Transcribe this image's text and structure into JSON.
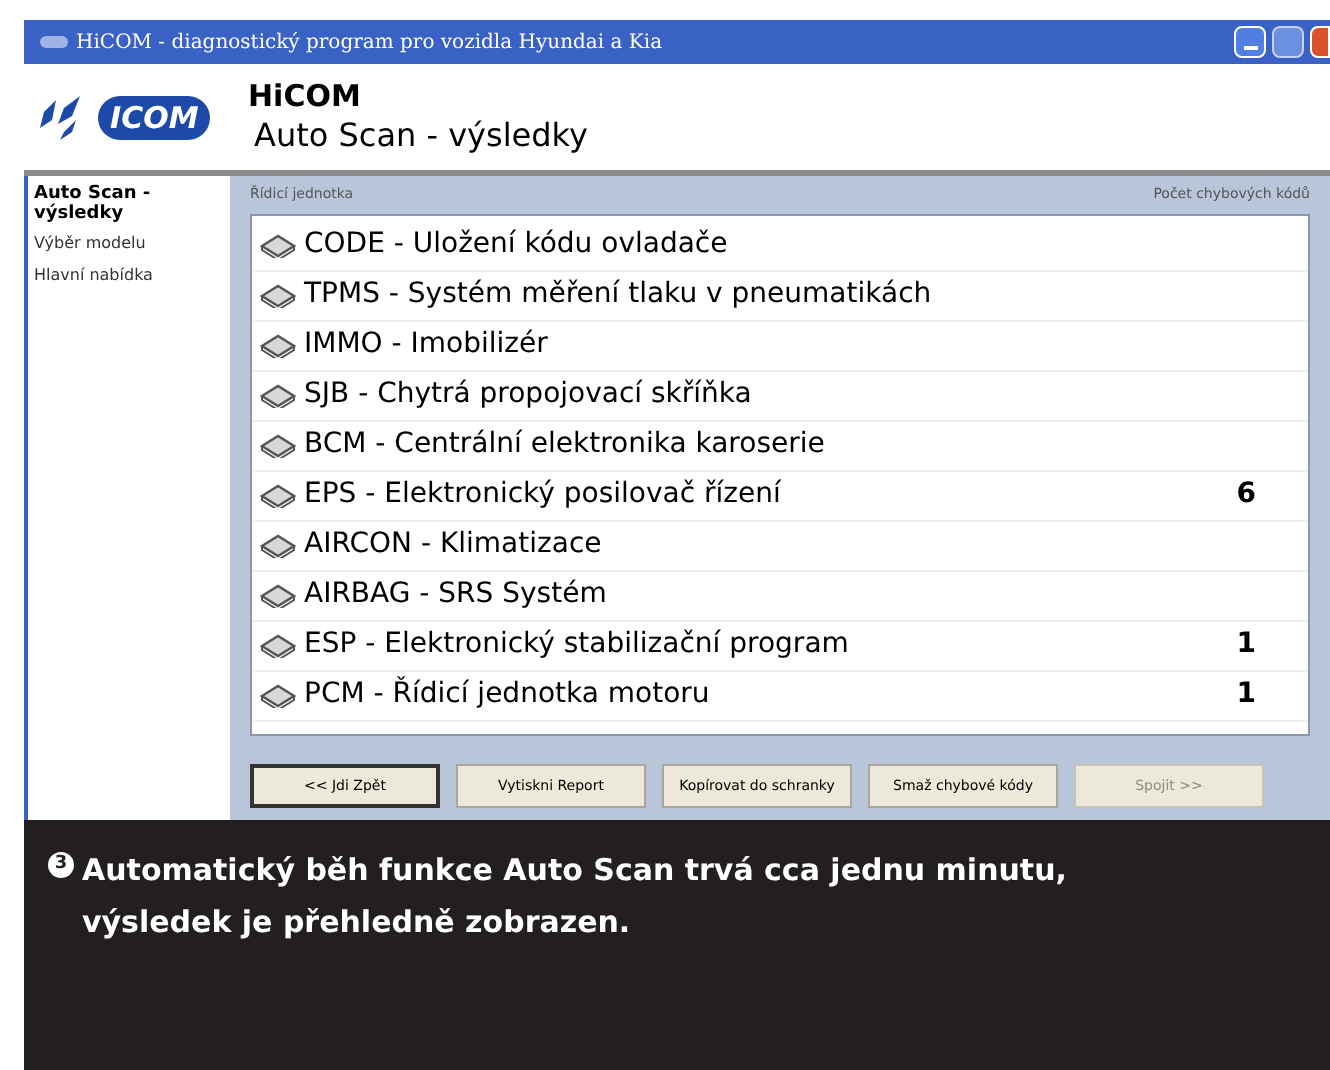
{
  "window": {
    "title": "HiCOM - diagnostický program pro vozidla Hyundai a Kia"
  },
  "header": {
    "logo": "ICOM",
    "title": "HiCOM",
    "subtitle": "Auto Scan - výsledky"
  },
  "sidebar": {
    "items": [
      {
        "label": "Auto Scan - výsledky",
        "selected": true
      },
      {
        "label": "Výběr modelu",
        "selected": false
      },
      {
        "label": "Hlavní nabídka",
        "selected": false
      }
    ]
  },
  "table": {
    "columns": [
      "Řídicí jednotka",
      "Počet chybových kódů"
    ],
    "rows": [
      {
        "unit": "CODE - Uložení kódu ovladače",
        "count": ""
      },
      {
        "unit": "TPMS - Systém měření tlaku v pneumatikách",
        "count": ""
      },
      {
        "unit": "IMMO - Imobilizér",
        "count": ""
      },
      {
        "unit": "SJB - Chytrá propojovací skříňka",
        "count": ""
      },
      {
        "unit": "BCM - Centrální elektronika karoserie",
        "count": ""
      },
      {
        "unit": "EPS - Elektronický posilovač řízení",
        "count": "6"
      },
      {
        "unit": "AIRCON - Klimatizace",
        "count": ""
      },
      {
        "unit": "AIRBAG - SRS Systém",
        "count": ""
      },
      {
        "unit": "ESP - Elektronický stabilizační program",
        "count": "1"
      },
      {
        "unit": "PCM - Řídicí jednotka motoru",
        "count": "1"
      }
    ]
  },
  "buttons": [
    {
      "label": "<< Jdi Zpět",
      "disabled": false
    },
    {
      "label": "Vytiskni Report",
      "disabled": false
    },
    {
      "label": "Kopírovat do schranky",
      "disabled": false
    },
    {
      "label": "Smaž chybové kódy",
      "disabled": false
    },
    {
      "label": "Spojit >>",
      "disabled": true
    }
  ],
  "caption": {
    "number": "3",
    "text": "Automatický běh funkce Auto Scan trvá cca jednu minutu, výsledek je přehledně zobrazen."
  }
}
